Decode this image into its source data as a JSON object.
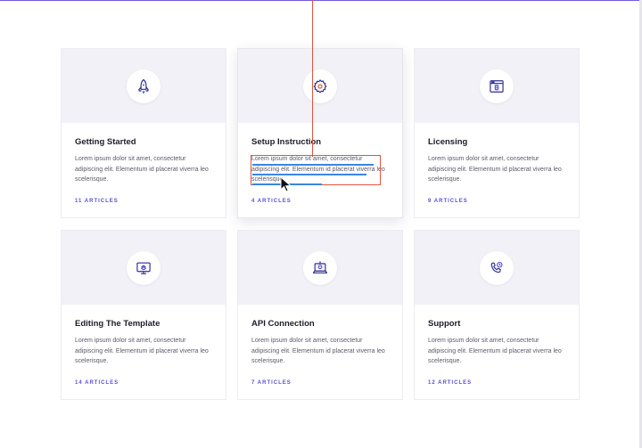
{
  "colors": {
    "accent": "#5b4fd8",
    "card_header_bg": "#f1f1f7",
    "selection_outline": "#e0553d",
    "text_highlight": "#3b86e0"
  },
  "cards": [
    {
      "title": "Getting Started",
      "description": "Lorem ipsum dolor sit amet, consectetur adipiscing elit. Elementum id placerat viverra leo scelerisque.",
      "count": "11 ARTICLES",
      "icon": "rocket-icon"
    },
    {
      "title": "Setup Instruction",
      "description": "Lorem ipsum dolor sit amet, consectetur adipiscing elit. Elementum id placerat viverra leo scelerisque.",
      "count": "4 ARTICLES",
      "icon": "gear-icon"
    },
    {
      "title": "Licensing",
      "description": "Lorem ipsum dolor sit amet, consectetur adipiscing elit. Elementum id placerat viverra leo scelerisque.",
      "count": "9 ARTICLES",
      "icon": "browser-license-icon"
    },
    {
      "title": "Editing The Template",
      "description": "Lorem ipsum dolor sit amet, consectetur adipiscing elit. Elementum id placerat viverra leo scelerisque.",
      "count": "14 ARTICLES",
      "icon": "monitor-icon"
    },
    {
      "title": "API Connection",
      "description": "Lorem ipsum dolor sit amet, consectetur adipiscing elit. Elementum id placerat viverra leo scelerisque.",
      "count": "7 ARTICLES",
      "icon": "laptop-connection-icon"
    },
    {
      "title": "Support",
      "description": "Lorem ipsum dolor sit amet, consectetur adipiscing elit. Elementum id placerat viverra leo scelerisque.",
      "count": "12 ARTICLES",
      "icon": "phone-support-icon"
    }
  ]
}
